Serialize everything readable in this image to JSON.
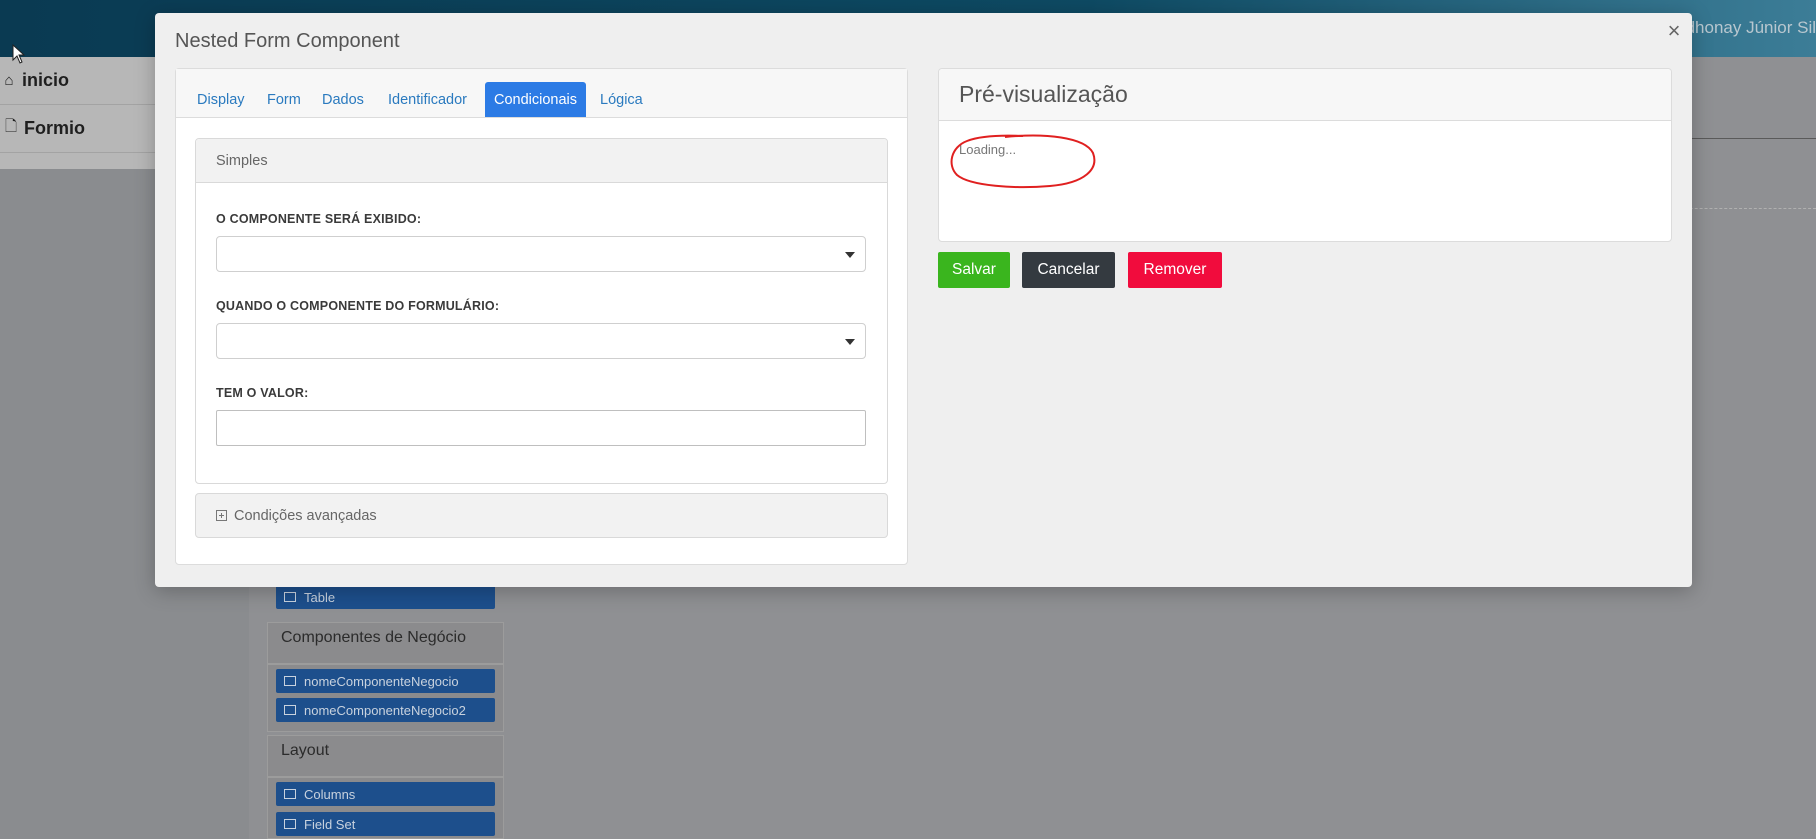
{
  "background": {
    "user_name": "dhonay Júnior Sil",
    "sidebar": [
      {
        "icon": "home-icon",
        "label": "inicio"
      },
      {
        "icon": "file-icon",
        "label": "Formio"
      }
    ],
    "builder_groups": [
      {
        "title": "",
        "items": [
          "Table"
        ]
      },
      {
        "title": "Componentes de Negócio",
        "items": [
          "nomeComponenteNegocio",
          "nomeComponenteNegocio2"
        ]
      },
      {
        "title": "Layout",
        "items": [
          "Columns",
          "Field Set"
        ]
      }
    ]
  },
  "modal": {
    "title": "Nested Form Component",
    "close_label": "×",
    "tabs": [
      {
        "label": "Display",
        "active": false
      },
      {
        "label": "Form",
        "active": false
      },
      {
        "label": "Dados",
        "active": false
      },
      {
        "label": "Identificador",
        "active": false
      },
      {
        "label": "Condicionais",
        "active": true
      },
      {
        "label": "Lógica",
        "active": false
      }
    ],
    "simple_panel": {
      "title": "Simples",
      "show_label": "O COMPONENTE SERÁ EXIBIDO:",
      "show_value": "",
      "when_label": "QUANDO O COMPONENTE DO FORMULÁRIO:",
      "when_value": "",
      "value_label": "TEM O VALOR:",
      "value_value": ""
    },
    "advanced_panel": {
      "title": "Condições avançadas"
    },
    "preview": {
      "title": "Pré-visualização",
      "loading_text": "Loading..."
    },
    "buttons": {
      "save": "Salvar",
      "cancel": "Cancelar",
      "remove": "Remover"
    }
  },
  "colors": {
    "tab_active": "#2c7be5",
    "save": "#3ab51e",
    "cancel": "#343a40",
    "remove": "#f10c3d",
    "annotation": "#e02020"
  }
}
